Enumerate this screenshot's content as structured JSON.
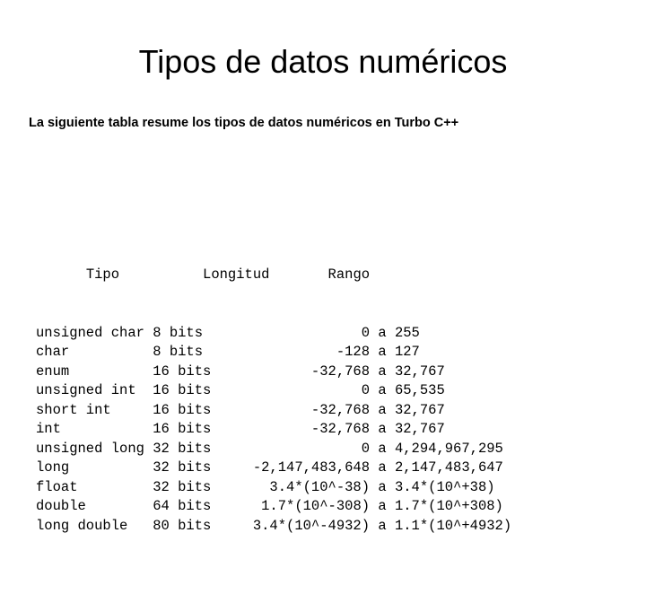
{
  "slide": {
    "title": "Tipos de datos numéricos",
    "subtitle": "La siguiente tabla resume los tipos de datos numéricos en Turbo C++",
    "background_color": "#ffffff",
    "text_color": "#000000"
  },
  "table": {
    "headers": {
      "tipo": "Tipo",
      "longitud": "Longitud",
      "rango": "Rango"
    },
    "separator": "a",
    "rows": [
      {
        "tipo": "unsigned char",
        "longitud": "8 bits",
        "rango_min": "0",
        "rango_max": "255"
      },
      {
        "tipo": "char",
        "longitud": "8 bits",
        "rango_min": "-128",
        "rango_max": "127"
      },
      {
        "tipo": "enum",
        "longitud": "16 bits",
        "rango_min": "-32,768",
        "rango_max": "32,767"
      },
      {
        "tipo": "unsigned int",
        "longitud": "16 bits",
        "rango_min": "0",
        "rango_max": "65,535"
      },
      {
        "tipo": "short int",
        "longitud": "16 bits",
        "rango_min": "-32,768",
        "rango_max": "32,767"
      },
      {
        "tipo": "int",
        "longitud": "16 bits",
        "rango_min": "-32,768",
        "rango_max": "32,767"
      },
      {
        "tipo": "unsigned long",
        "longitud": "32 bits",
        "rango_min": "0",
        "rango_max": "4,294,967,295"
      },
      {
        "tipo": "long",
        "longitud": "32 bits",
        "rango_min": "-2,147,483,648",
        "rango_max": "2,147,483,647"
      },
      {
        "tipo": "float",
        "longitud": "32 bits",
        "rango_min": "3.4*(10^-38)",
        "rango_max": "3.4*(10^+38)"
      },
      {
        "tipo": "double",
        "longitud": "64 bits",
        "rango_min": "1.7*(10^-308)",
        "rango_max": "1.7*(10^+308)"
      },
      {
        "tipo": "long double",
        "longitud": "80 bits",
        "rango_min": "3.4*(10^-4932)",
        "rango_max": "1.1*(10^+4932)"
      }
    ]
  }
}
